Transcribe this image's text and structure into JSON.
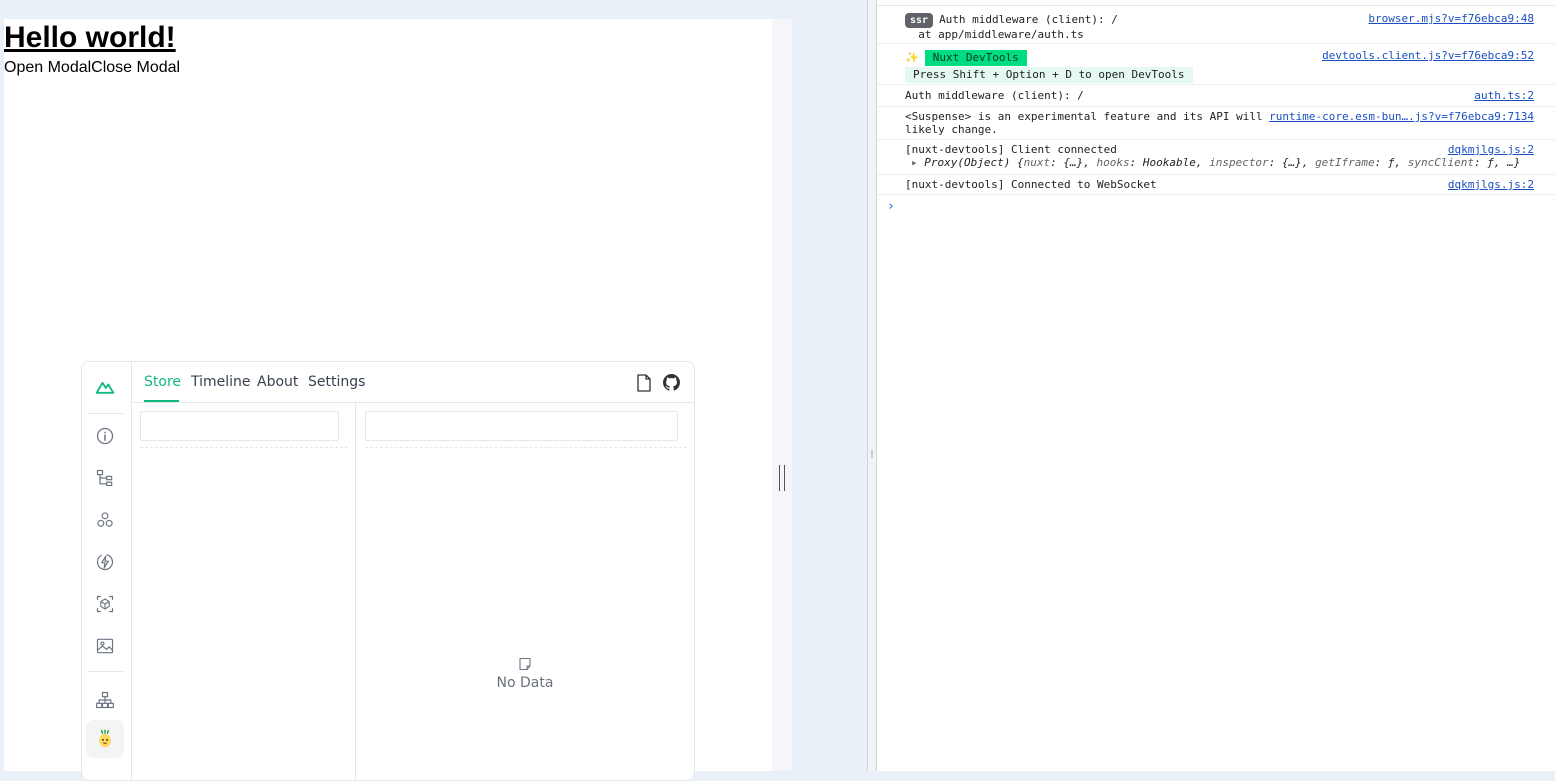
{
  "page": {
    "heading": "Hello world!",
    "open_modal": "Open Modal",
    "close_modal": "Close Modal"
  },
  "devtools": {
    "tabs": [
      {
        "label": "Store",
        "active": true
      },
      {
        "label": "Timeline",
        "active": false
      },
      {
        "label": "About",
        "active": false
      },
      {
        "label": "Settings",
        "active": false
      }
    ],
    "rail_icons": [
      "nuxt-logo-icon",
      "info-icon",
      "component-tree-icon",
      "components-icon",
      "lightning-icon",
      "box-icon",
      "image-icon",
      "hierarchy-icon",
      "pinia-icon"
    ],
    "store_search_left_placeholder": "",
    "store_search_right_placeholder": "",
    "empty_label": "No Data",
    "accent_color": "#10b981"
  },
  "console": {
    "rows": [
      {
        "badge": "ssr",
        "text": "Auth middleware (client): /",
        "subtext": "  at app/middleware/auth.ts",
        "source": "browser.mjs?v=f76ebca9:48"
      },
      {
        "emoji": "✨",
        "badge": "Nuxt DevTools",
        "subtext": "Press Shift + Option + D to open DevTools",
        "source": "devtools.client.js?v=f76ebca9:52"
      },
      {
        "text": "Auth middleware (client): /",
        "source": "auth.ts:2"
      },
      {
        "text": "<Suspense> is an experimental feature and its API will",
        "subtext": "likely change.",
        "source": "runtime-core.esm-bun….js?v=f76ebca9:7134"
      },
      {
        "text": "[nuxt-devtools] Client connected",
        "source": "dqkmjlgs.js:2",
        "object": {
          "prefix": "Proxy(Object) {",
          "parts": [
            {
              "key": "nuxt",
              "value": "{…}"
            },
            {
              "key": "hooks",
              "value": "Hookable"
            },
            {
              "key": "inspector",
              "value": "{…}"
            },
            {
              "key": "getIframe",
              "value": "ƒ"
            },
            {
              "key": "syncClient",
              "value": "ƒ"
            }
          ],
          "suffix": "…}"
        }
      },
      {
        "text": "[nuxt-devtools] Connected to WebSocket",
        "source": "dqkmjlgs.js:2"
      }
    ],
    "prompt": "›"
  }
}
